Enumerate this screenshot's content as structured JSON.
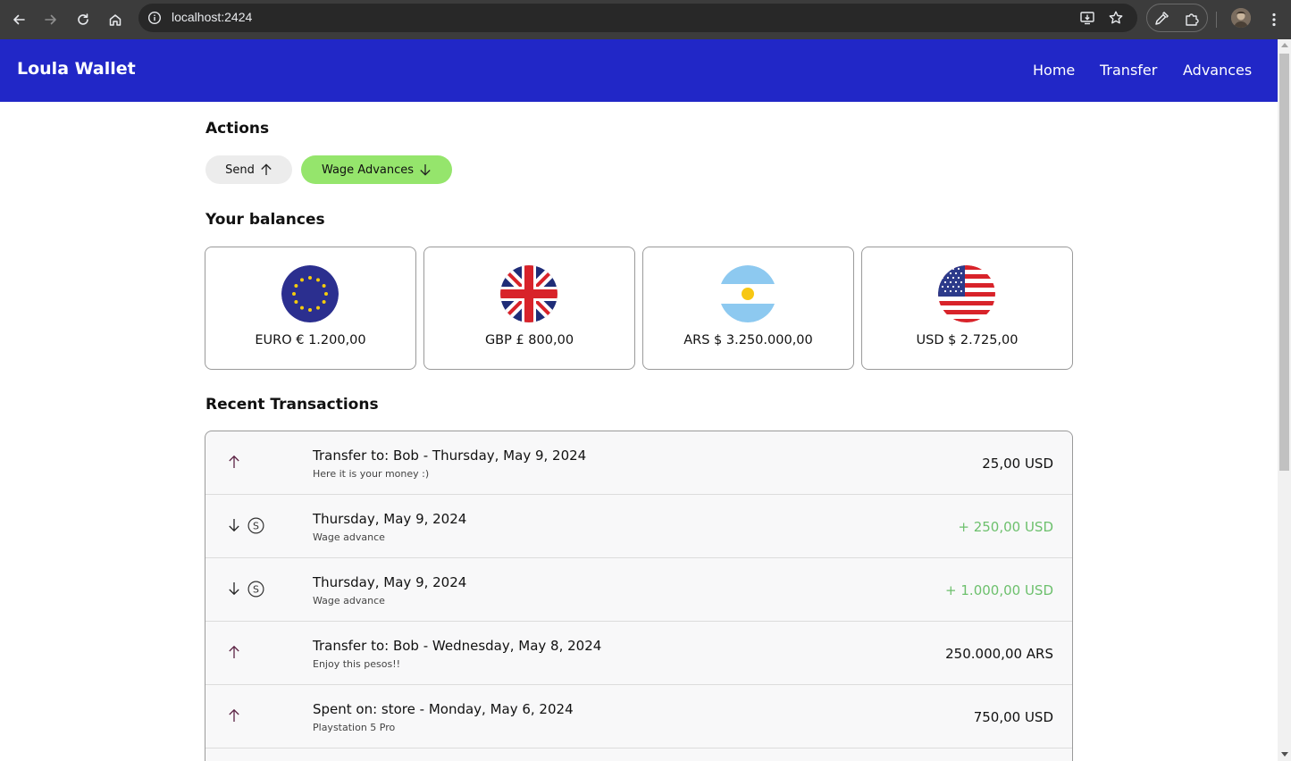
{
  "browser": {
    "url": "localhost:2424",
    "icons": {
      "back": "back-arrow-icon",
      "forward": "forward-arrow-icon",
      "reload": "reload-icon",
      "home": "home-icon",
      "info": "info-icon",
      "install": "install-app-icon",
      "bookmark": "star-icon",
      "extension_1": "eyedropper-icon",
      "extension_2": "puzzle-icon",
      "menu": "kebab-menu-icon"
    }
  },
  "header": {
    "brand": "Loula Wallet",
    "nav": [
      "Home",
      "Transfer",
      "Advances"
    ],
    "background_color": "#2127c7"
  },
  "actions": {
    "title": "Actions",
    "send_label": "Send",
    "send_icon": "arrow-up-icon",
    "advances_label": "Wage Advances",
    "advances_icon": "arrow-down-icon",
    "send_color": "#ececec",
    "advances_color": "#95e56c"
  },
  "balances": {
    "title": "Your balances",
    "items": [
      {
        "label": "EURO € 1.200,00",
        "flag": "eu-flag-icon"
      },
      {
        "label": "GBP £ 800,00",
        "flag": "uk-flag-icon"
      },
      {
        "label": "ARS $ 3.250.000,00",
        "flag": "argentina-flag-icon"
      },
      {
        "label": "USD $ 2.725,00",
        "flag": "us-flag-icon"
      }
    ]
  },
  "transactions": {
    "title": "Recent Transactions",
    "credit_color": "#6dc06d",
    "items": [
      {
        "title": "Transfer to: Bob - Thursday, May 9, 2024",
        "subtitle": "Here it is your money :)",
        "amount": "25,00 USD",
        "type": "outgoing"
      },
      {
        "title": "Thursday, May 9, 2024",
        "subtitle": "Wage advance",
        "amount": "+ 250,00 USD",
        "type": "advance"
      },
      {
        "title": "Thursday, May 9, 2024",
        "subtitle": "Wage advance",
        "amount": "+ 1.000,00 USD",
        "type": "advance"
      },
      {
        "title": "Transfer to: Bob - Wednesday, May 8, 2024",
        "subtitle": "Enjoy this pesos!!",
        "amount": "250.000,00 ARS",
        "type": "outgoing"
      },
      {
        "title": "Spent on: store - Monday, May 6, 2024",
        "subtitle": "Playstation 5 Pro",
        "amount": "750,00 USD",
        "type": "outgoing"
      }
    ]
  }
}
